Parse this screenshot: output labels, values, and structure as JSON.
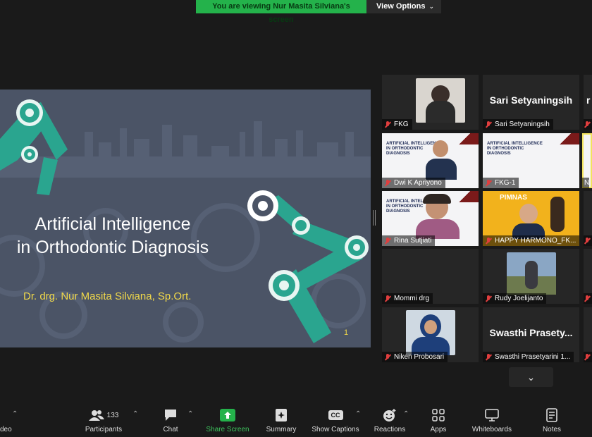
{
  "banner": {
    "viewing_text": "You are viewing Nur Masita Silviana's screen",
    "options_label": "View Options"
  },
  "slide": {
    "title_line1": "Artificial Intelligence",
    "title_line2": "in Orthodontic Diagnosis",
    "author": "Dr. drg. Nur Masita Silviana, Sp.Ort.",
    "page_number": "1"
  },
  "gallery": {
    "tiles": [
      {
        "name": "FKG"
      },
      {
        "name": "Sari Setyaningsih",
        "big": "Sari Setyaningsih"
      },
      {
        "name": "Dwi K Apriyono"
      },
      {
        "name": "FKG-1"
      },
      {
        "name": "Rina Sutjiati"
      },
      {
        "name": "HAPPY HARMONO_FK..."
      },
      {
        "name": "Mommi drg"
      },
      {
        "name": "Rudy Joelijanto"
      },
      {
        "name": "Niken Probosari"
      },
      {
        "name": "Swasthi Prasetyarini 1...",
        "big": "Swasthi  Prasety..."
      }
    ],
    "partial_big": "r",
    "partial_label": "N",
    "slide_thumb_title": "ARTIFICIAL INTELLIGENCE\nIN ORTHODONTIC\nDIAGNOSIS",
    "pimnas_text": "PIMNAS"
  },
  "toolbar": {
    "video_label": "deo",
    "participants_label": "Participants",
    "participants_count": "133",
    "chat_label": "Chat",
    "share_label": "Share Screen",
    "summary_label": "Summary",
    "captions_label": "Show Captions",
    "captions_badge": "CC",
    "reactions_label": "Reactions",
    "apps_label": "Apps",
    "whiteboards_label": "Whiteboards",
    "notes_label": "Notes"
  },
  "colors": {
    "share_green": "#24b24b",
    "slide_bg": "#4b5466",
    "robot_teal": "#2aa58f",
    "author_yellow": "#f0d84a",
    "mic_red": "#e03e3e"
  }
}
